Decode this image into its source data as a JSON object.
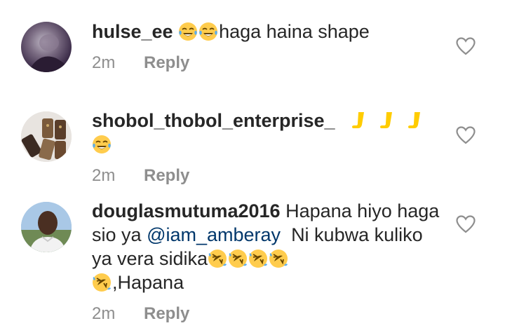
{
  "comments": [
    {
      "username": "hulse_ee",
      "emoji_prefix": [
        "tears-of-joy",
        "tears-of-joy"
      ],
      "text": "haga haina shape",
      "time": "2m",
      "reply_label": "Reply"
    },
    {
      "username": "shobol_thobol_enterprise_",
      "emoji_suffix": [
        "leg",
        "leg",
        "leg",
        "tears-of-joy"
      ],
      "time": "2m",
      "reply_label": "Reply"
    },
    {
      "username": "douglasmutuma2016",
      "text_part1": "Hapana hiyo haga sio ya",
      "mention": "@iam_amberay",
      "text_part2": "Ni kubwa kuliko ya vera sidika",
      "emoji_mid": [
        "rofl",
        "rofl",
        "rofl",
        "rofl",
        "rofl"
      ],
      "text_part3": ",Hapana",
      "time": "2m",
      "reply_label": "Reply"
    }
  ],
  "colors": {
    "text": "#262626",
    "meta": "#8e8e8e",
    "mention": "#00376b",
    "heart_stroke": "#8e8e8e"
  }
}
